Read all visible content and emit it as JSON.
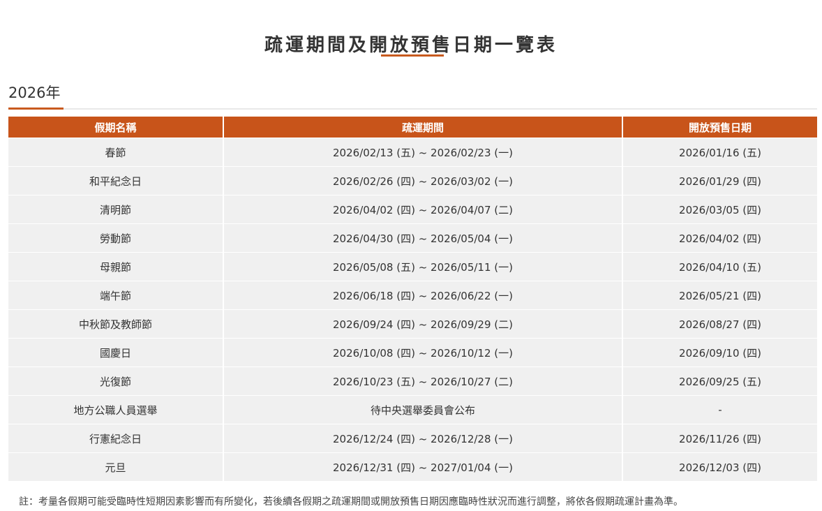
{
  "page": {
    "title": "疏運期間及開放預售日期一覽表"
  },
  "section": {
    "year": "2026年"
  },
  "table": {
    "headers": [
      "假期名稱",
      "疏運期間",
      "開放預售日期"
    ],
    "rows": [
      {
        "name": "春節",
        "period": "2026/02/13 (五) ~ 2026/02/23 (一)",
        "presale": "2026/01/16 (五)"
      },
      {
        "name": "和平紀念日",
        "period": "2026/02/26 (四) ~ 2026/03/02 (一)",
        "presale": "2026/01/29 (四)"
      },
      {
        "name": "清明節",
        "period": "2026/04/02 (四) ~ 2026/04/07 (二)",
        "presale": "2026/03/05 (四)"
      },
      {
        "name": "勞動節",
        "period": "2026/04/30 (四) ~ 2026/05/04 (一)",
        "presale": "2026/04/02 (四)"
      },
      {
        "name": "母親節",
        "period": "2026/05/08 (五) ~ 2026/05/11 (一)",
        "presale": "2026/04/10 (五)"
      },
      {
        "name": "端午節",
        "period": "2026/06/18 (四) ~ 2026/06/22 (一)",
        "presale": "2026/05/21 (四)"
      },
      {
        "name": "中秋節及教師節",
        "period": "2026/09/24 (四) ~ 2026/09/29 (二)",
        "presale": "2026/08/27 (四)"
      },
      {
        "name": "國慶日",
        "period": "2026/10/08 (四) ~ 2026/10/12 (一)",
        "presale": "2026/09/10 (四)"
      },
      {
        "name": "光復節",
        "period": "2026/10/23 (五) ~ 2026/10/27 (二)",
        "presale": "2026/09/25 (五)"
      },
      {
        "name": "地方公職人員選舉",
        "period": "待中央選舉委員會公布",
        "presale": "-"
      },
      {
        "name": "行憲紀念日",
        "period": "2026/12/24 (四) ~ 2026/12/28 (一)",
        "presale": "2026/11/26 (四)"
      },
      {
        "name": "元旦",
        "period": "2026/12/31 (四) ~ 2027/01/04 (一)",
        "presale": "2026/12/03 (四)"
      }
    ]
  },
  "footnote": "註：考量各假期可能受臨時性短期因素影響而有所變化，若後續各假期之疏運期間或開放預售日期因應臨時性狀況而進行調整，將依各假期疏運計畫為準。",
  "colors": {
    "accent": "#c85a1e",
    "header_bg": "#c8541a",
    "row_bg": "#f0f0f0"
  }
}
